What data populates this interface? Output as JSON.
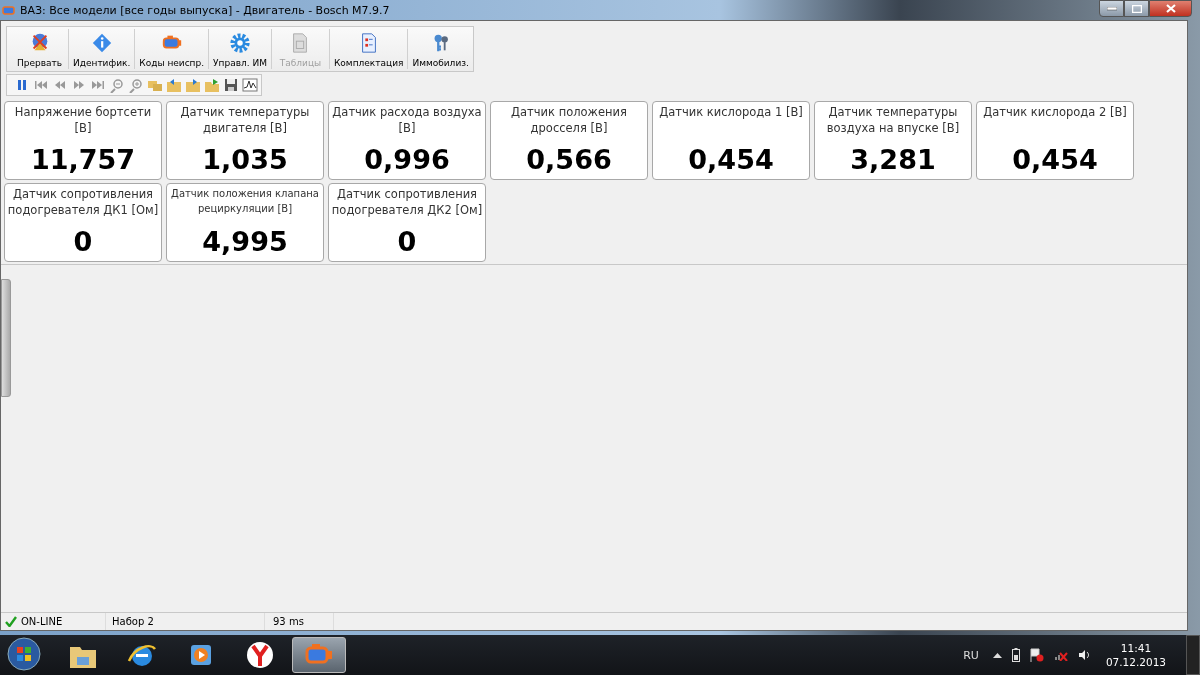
{
  "window": {
    "title": "ВАЗ: Все модели [все годы выпуска] - Двигатель - Bosch M7.9.7"
  },
  "toolbar": [
    {
      "label": "Прервать",
      "kind": "stop",
      "disabled": false
    },
    {
      "label": "Идентифик.",
      "kind": "info",
      "disabled": false
    },
    {
      "label": "Коды неиспр.",
      "kind": "engine",
      "disabled": false
    },
    {
      "label": "Управл. ИМ",
      "kind": "gear",
      "disabled": false
    },
    {
      "label": "Таблицы",
      "kind": "table",
      "disabled": true
    },
    {
      "label": "Комплектация",
      "kind": "checklist",
      "disabled": false
    },
    {
      "label": "Иммобилиз.",
      "kind": "key",
      "disabled": false
    }
  ],
  "player_toolbar": [
    {
      "kind": "pause"
    },
    {
      "kind": "first"
    },
    {
      "kind": "back"
    },
    {
      "kind": "forward"
    },
    {
      "kind": "last"
    },
    {
      "kind": "zoomout"
    },
    {
      "kind": "zoomin"
    },
    {
      "kind": "folders"
    },
    {
      "kind": "folderback"
    },
    {
      "kind": "folderforward"
    },
    {
      "kind": "folderopen"
    },
    {
      "kind": "save"
    },
    {
      "kind": "graph"
    }
  ],
  "gauges": [
    {
      "label": "Напряжение бортсети [В]",
      "value": "11,757",
      "compact": false
    },
    {
      "label": "Датчик температуры двигателя [В]",
      "value": "1,035",
      "compact": false
    },
    {
      "label": "Датчик расхода воздуха [В]",
      "value": "0,996",
      "compact": false
    },
    {
      "label": "Датчик положения дросселя [В]",
      "value": "0,566",
      "compact": false
    },
    {
      "label": "Датчик кислорода 1 [В]",
      "value": "0,454",
      "compact": false
    },
    {
      "label": "Датчик температуры воздуха на впуске [В]",
      "value": "3,281",
      "compact": false
    },
    {
      "label": "Датчик кислорода 2 [В]",
      "value": "0,454",
      "compact": false
    },
    {
      "label": "Датчик сопротивления подогревателя ДК1 [Ом]",
      "value": "0",
      "compact": false
    },
    {
      "label": "Датчик положения клапана рециркуляции [В]",
      "value": "4,995",
      "compact": true
    },
    {
      "label": "Датчик сопротивления подогревателя ДК2 [Ом]",
      "value": "0",
      "compact": false
    }
  ],
  "status_bar": {
    "connection": "ON-LINE",
    "online": true,
    "set": "Набор 2",
    "latency": "93 ms"
  },
  "taskbar": {
    "apps": [
      {
        "kind": "folder",
        "selected": false
      },
      {
        "kind": "ie",
        "selected": false
      },
      {
        "kind": "player",
        "selected": false
      },
      {
        "kind": "yandex",
        "selected": false
      },
      {
        "kind": "diag",
        "selected": true
      }
    ],
    "language": "RU",
    "time": "11:41",
    "date": "07.12.2013"
  }
}
